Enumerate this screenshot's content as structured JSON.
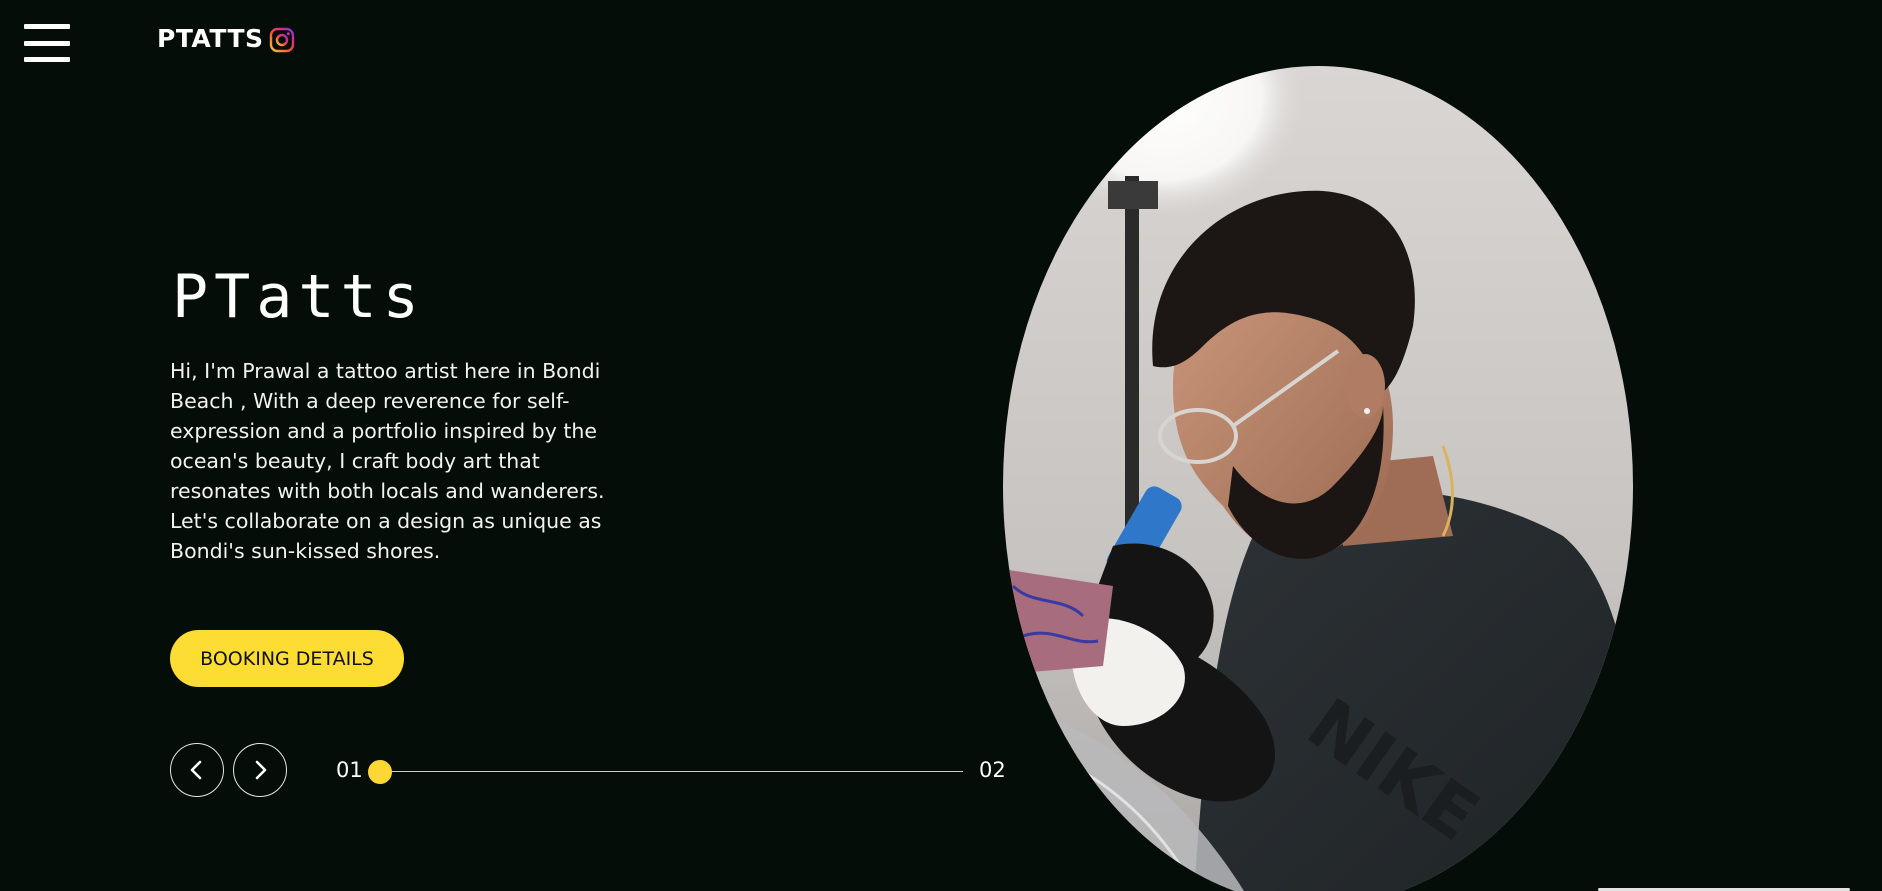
{
  "header": {
    "brand": "PTATTS",
    "menu_icon": "hamburger-menu-icon",
    "social_icon": "instagram-icon"
  },
  "hero": {
    "title": "PTatts",
    "description": "Hi, I'm Prawal a tattoo artist here in Bondi Beach , With a deep reverence for self-expression and a portfolio inspired by the ocean's beauty, I craft body art that resonates with both locals and wanderers. Let's collaborate on a design as unique as Bondi's sun-kissed shores.",
    "cta_label": "BOOKING DETAILS"
  },
  "slider": {
    "start_label": "01",
    "end_label": "02",
    "position": 0,
    "prev_icon": "chevron-left-icon",
    "next_icon": "chevron-right-icon"
  },
  "portrait": {
    "subject": "tattoo artist at work photo"
  },
  "colors": {
    "background": "#040d07",
    "accent": "#fddd34",
    "text": "#ffffff"
  }
}
